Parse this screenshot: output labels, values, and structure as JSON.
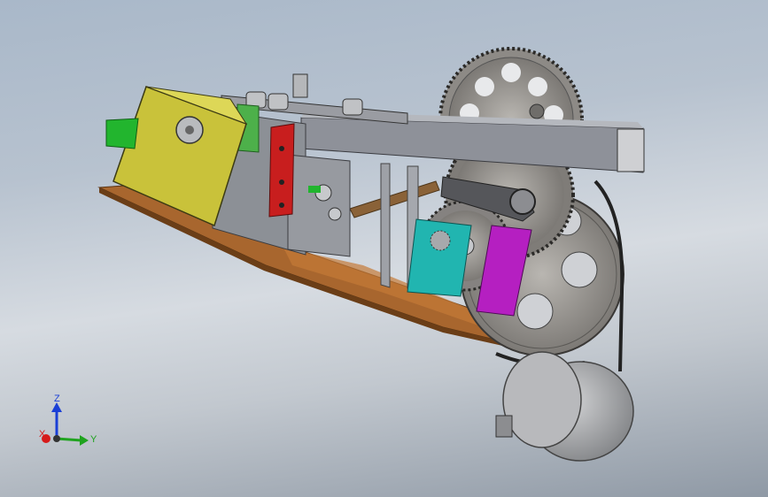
{
  "viewport": {
    "background_top": "#a9b8c9",
    "background_bottom": "#8f99a5"
  },
  "triad": {
    "z_label": "Z",
    "y_label": "Y",
    "x_label": "X",
    "z_color": "#1a3fd6",
    "y_color": "#1fa31f",
    "x_color": "#d61a1a"
  },
  "parts": {
    "colors": {
      "housing": "#c9c23a",
      "base_plate": "#a8662e",
      "frame": "#8e9199",
      "red_block": "#c81e1e",
      "green_motor": "#22b52e",
      "teal_block": "#21b5b0",
      "magenta_block": "#b51fc1",
      "gear": "#8d8a86",
      "motor": "#a7a8ab"
    }
  }
}
